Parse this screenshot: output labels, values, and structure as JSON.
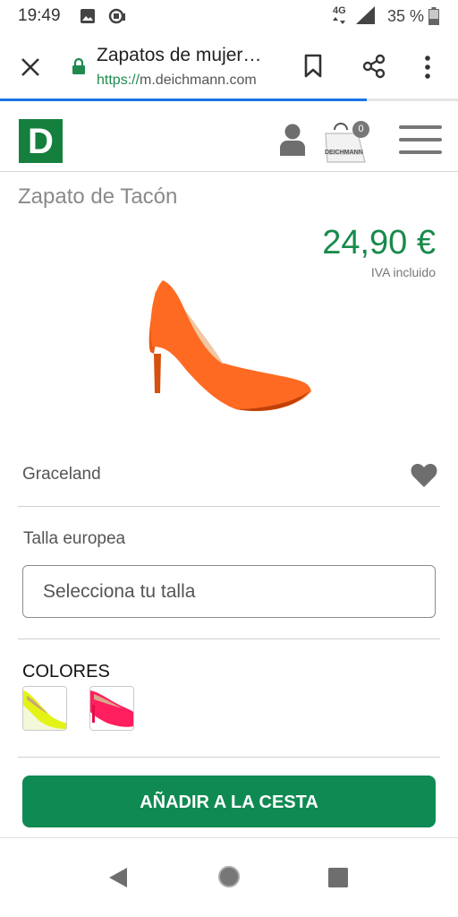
{
  "status_bar": {
    "time": "19:49",
    "network": "4G",
    "battery": "35 %"
  },
  "browser": {
    "title": "Zapatos de mujer…",
    "url_scheme": "https://",
    "url_host": "m.deichmann.com",
    "load_progress": 0.8
  },
  "site_header": {
    "logo_letter": "D",
    "cart_count": "0",
    "cart_bag_text": "DEICHMANN"
  },
  "product": {
    "title": "Zapato de Tacón",
    "price": "24,90 €",
    "vat_note": "IVA incluido",
    "brand": "Graceland",
    "size_label": "Talla europea",
    "size_placeholder": "Selecciona tu talla",
    "colors_label": "COLORES",
    "colors": [
      {
        "icon": "yellow-heel-thumbnail",
        "color": "#e4f316"
      },
      {
        "icon": "pink-heel-thumbnail",
        "color": "#ff1e5e"
      }
    ],
    "main_color": "#ff6a22",
    "add_to_cart": "AÑADIR A LA CESTA"
  },
  "colors": {
    "brand_green": "#178a4b",
    "button_green": "#0f8a52",
    "accent_blue": "#1a73e8"
  }
}
